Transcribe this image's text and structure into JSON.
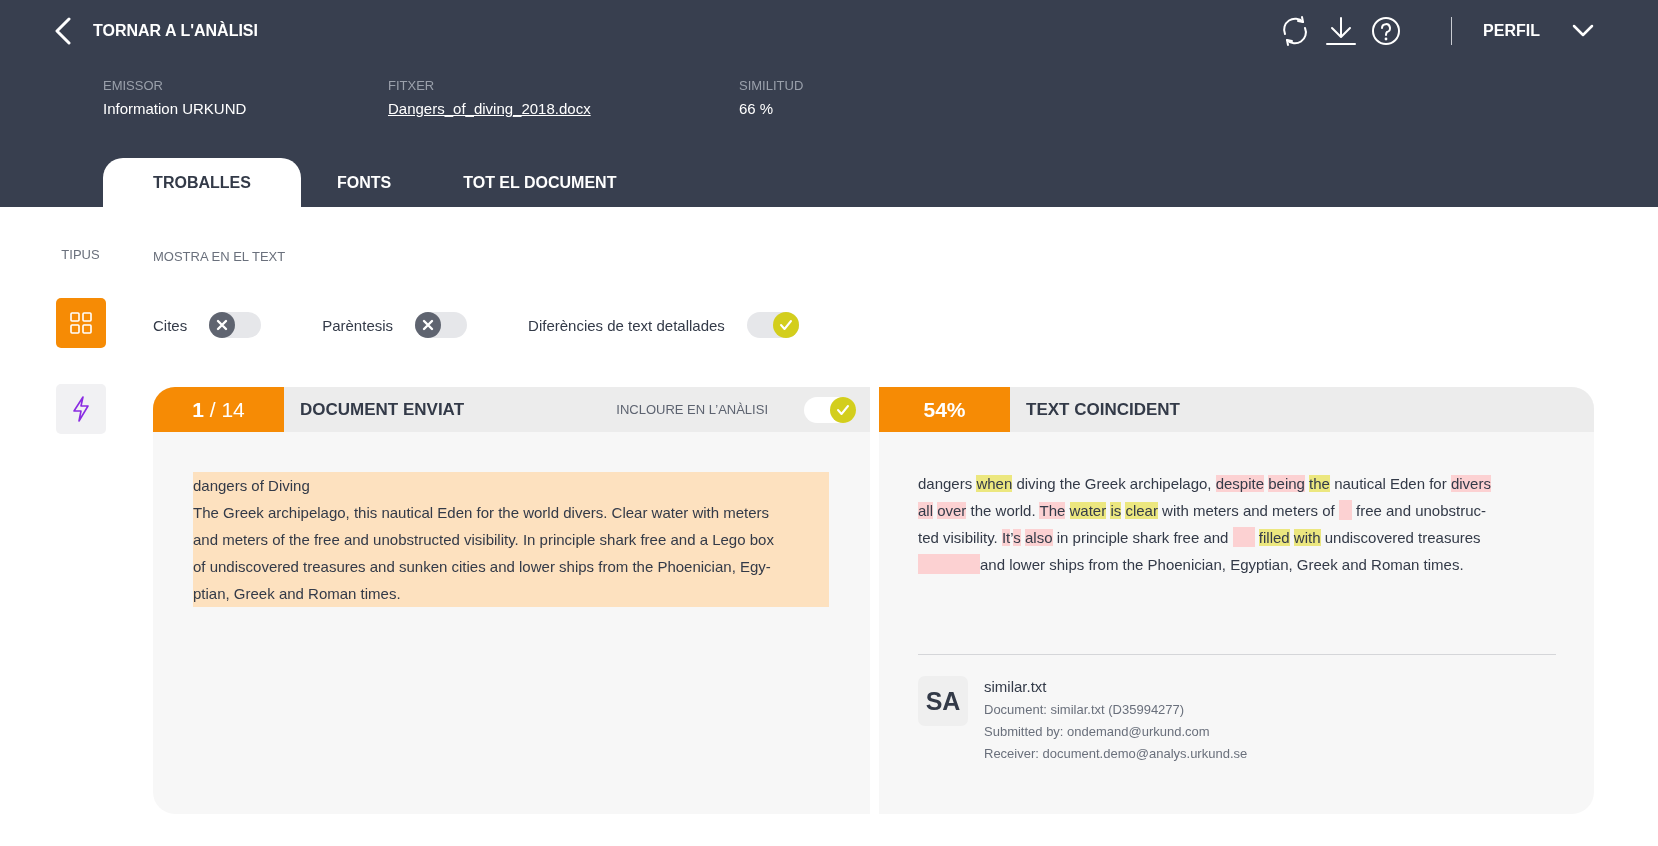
{
  "header": {
    "back_label": "TORNAR A L'ANÀLISI",
    "profile": "PERFIL"
  },
  "meta": [
    {
      "label": "EMISSOR",
      "value": "Information URKUND",
      "link": false
    },
    {
      "label": "FITXER",
      "value": "Dangers_of_diving_2018.docx",
      "link": true
    },
    {
      "label": "SIMILITUD",
      "value": "66 %",
      "link": false
    }
  ],
  "tabs": [
    {
      "label": "TROBALLES",
      "selected": true
    },
    {
      "label": "FONTS",
      "selected": false
    },
    {
      "label": "TOT EL DOCUMENT",
      "selected": false
    }
  ],
  "types": {
    "label": "TIPUS",
    "items": [
      {
        "kind": "grid",
        "selected": true
      },
      {
        "kind": "bolt",
        "selected": false
      }
    ]
  },
  "show_in_text": {
    "label": "MOSTRA EN EL TEXT",
    "toggles": [
      {
        "label": "Cites",
        "on": false
      },
      {
        "label": "Parèntesis",
        "on": false
      },
      {
        "label": "Diferències de text detallades",
        "on": true
      }
    ]
  },
  "submitted": {
    "counter": "**1** / 14",
    "title": "DOCUMENT ENVIAT",
    "include_label": "INCLOURE EN L’ANÀLISI",
    "include_on": true,
    "lines": [
      "dangers of Diving",
      "The Greek archipelago, this nautical Eden for the world divers. Clear water with meters",
      "and meters of the free and unobstructed visibility. In principle shark free and a Lego box",
      "of undiscovered treasures and sunken cities and lower ships from the Phoenician, Egy-",
      "ptian, Greek and Roman times."
    ]
  },
  "matching": {
    "percent": "54%",
    "title": "TEXT COINCIDENT",
    "lines": [
      [
        {
          "kind": "plain",
          "text": "dangers "
        },
        {
          "kind": "match",
          "text": "when"
        },
        {
          "kind": "plain",
          "text": " diving the Greek archipelago, "
        },
        {
          "kind": "mark",
          "text": "despite"
        },
        {
          "kind": "space"
        },
        {
          "kind": "mark",
          "text": "being"
        },
        {
          "kind": "space"
        },
        {
          "kind": "match",
          "text": "the"
        },
        {
          "kind": "plain",
          "text": " nautical Eden for "
        },
        {
          "kind": "mark",
          "text": "divers"
        }
      ],
      [
        {
          "kind": "mark",
          "text": "all"
        },
        {
          "kind": "space"
        },
        {
          "kind": "mark",
          "text": "over"
        },
        {
          "kind": "plain",
          "text": " the world. "
        },
        {
          "kind": "mark",
          "text": "The"
        },
        {
          "kind": "space"
        },
        {
          "kind": "match",
          "text": "water"
        },
        {
          "kind": "space"
        },
        {
          "kind": "match",
          "text": "is"
        },
        {
          "kind": "space"
        },
        {
          "kind": "match",
          "text": "clear"
        },
        {
          "kind": "plain",
          "text": " with meters and meters of "
        },
        {
          "kind": "gap"
        },
        {
          "kind": "plain",
          "text": " free and unobstruc-"
        }
      ],
      [
        {
          "kind": "plain",
          "text": "ted visibility. "
        },
        {
          "kind": "mark",
          "text": "It"
        },
        {
          "kind": "plain",
          "text": "’"
        },
        {
          "kind": "mark",
          "text": "s"
        },
        {
          "kind": "space"
        },
        {
          "kind": "mark",
          "text": "also"
        },
        {
          "kind": "plain",
          "text": " in principle shark free and "
        },
        {
          "kind": "widegap"
        },
        {
          "kind": "space"
        },
        {
          "kind": "match",
          "text": "filled"
        },
        {
          "kind": "space"
        },
        {
          "kind": "match",
          "text": "with"
        },
        {
          "kind": "plain",
          "text": " undiscovered treasures"
        }
      ],
      [
        {
          "kind": "longgap"
        },
        {
          "kind": "plain",
          "text": "and lower ships from the Phoenician, Egyptian, Greek and Roman times."
        }
      ]
    ],
    "source": {
      "initials": "SA",
      "name": "similar.txt",
      "details": [
        "Document: similar.txt (D35994277)",
        "Submitted by: ondemand@urkund.com",
        "Receiver: document.demo@analys.urkund.se"
      ]
    }
  }
}
